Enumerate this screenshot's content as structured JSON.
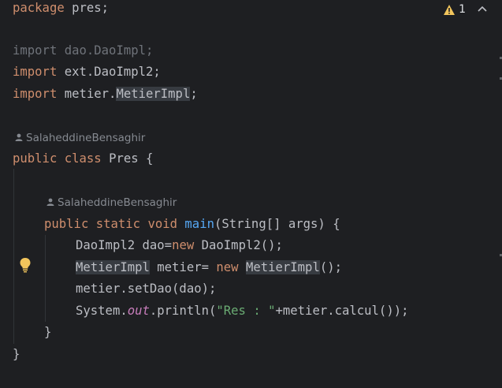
{
  "code": {
    "line1": {
      "kw": "package",
      "rest": " pres;"
    },
    "line3": {
      "kw": "import",
      "rest": " dao.DaoImpl;"
    },
    "line4": {
      "kw": "import",
      "rest": " ext.DaoImpl2;"
    },
    "line5": {
      "kw": "import",
      "pre": " metier.",
      "sel": "MetierImpl",
      "post": ";"
    },
    "author1": "SalaheddineBensaghir",
    "line7": {
      "kw1": "public",
      "kw2": "class",
      "rest": " Pres {"
    },
    "author2": "SalaheddineBensaghir",
    "line9": {
      "kw1": "public",
      "kw2": "static",
      "kw3": "void",
      "fn": "main",
      "rest": "(String[] args) {"
    },
    "line10": {
      "pre": "DaoImpl2 dao=",
      "kw": "new",
      "post": " DaoImpl2();"
    },
    "line11": {
      "type": "MetierImpl",
      "mid": " metier= ",
      "kw": "new",
      "sp": " ",
      "type2": "MetierImpl",
      "post": "();"
    },
    "line12": {
      "text": "metier.setDao(dao);"
    },
    "line13": {
      "pre": "System.",
      "stat": "out",
      "mid": ".println(",
      "str": "\"Res : \"",
      "post": "+metier.calcul());"
    },
    "line14": {
      "text": "}"
    },
    "line15": {
      "text": "}"
    }
  },
  "inspection": {
    "warning_count": "1",
    "warning_icon": "warning-triangle-icon",
    "nav_icon": "chevron-up-icon"
  },
  "colors": {
    "background": "#1e1f22",
    "keyword": "#cf8e6d",
    "function": "#56a8f5",
    "string": "#6aab73",
    "static": "#c77dbb",
    "text": "#bcbec4",
    "warning": "#f2c55c"
  }
}
